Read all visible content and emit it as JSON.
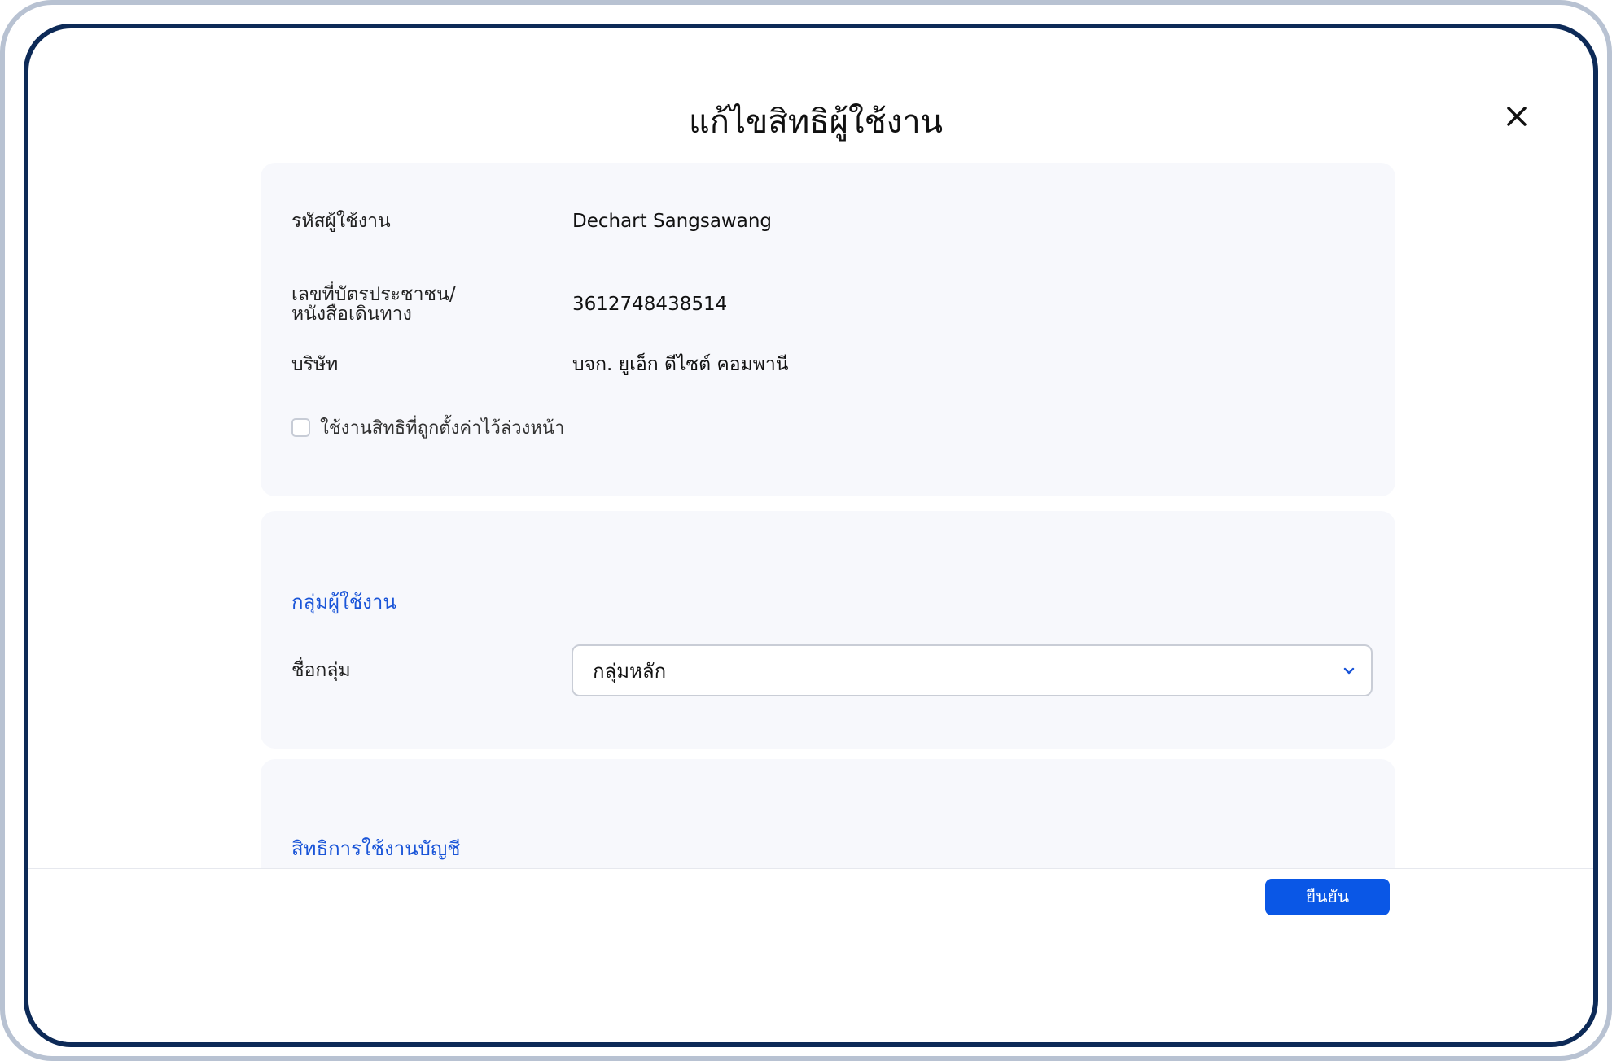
{
  "modal": {
    "title": "แก้ไขสิทธิผู้ใช้งาน"
  },
  "info": {
    "user_id_label": "รหัสผู้ใช้งาน",
    "user_id_value": "Dechart Sangsawang",
    "id_card_label_line1": "เลขที่บัตรประชาชน/",
    "id_card_label_line2": "หนังสือเดินทาง",
    "id_card_value": "3612748438514",
    "company_label": "บริษัท",
    "company_value": "บจก. ยูเอ็ก ดีไซต์ คอมพานี",
    "preset_checkbox_label": "ใช้งานสิทธิที่ถูกตั้งค่าไว้ล่วงหน้า",
    "preset_checked": false
  },
  "group": {
    "section_title": "กลุ่มผู้ใช้งาน",
    "name_label": "ชื่อกลุ่ม",
    "selected_value": "กลุ่มหลัก"
  },
  "permissions": {
    "section_title": "สิทธิการใช้งานบัญชี"
  },
  "footer": {
    "confirm_label": "ยืนยัน"
  },
  "colors": {
    "accent": "#0a57e6",
    "section_title": "#1a55d8",
    "card_bg": "#f7f8fc",
    "device_frame": "#0d2a57"
  }
}
